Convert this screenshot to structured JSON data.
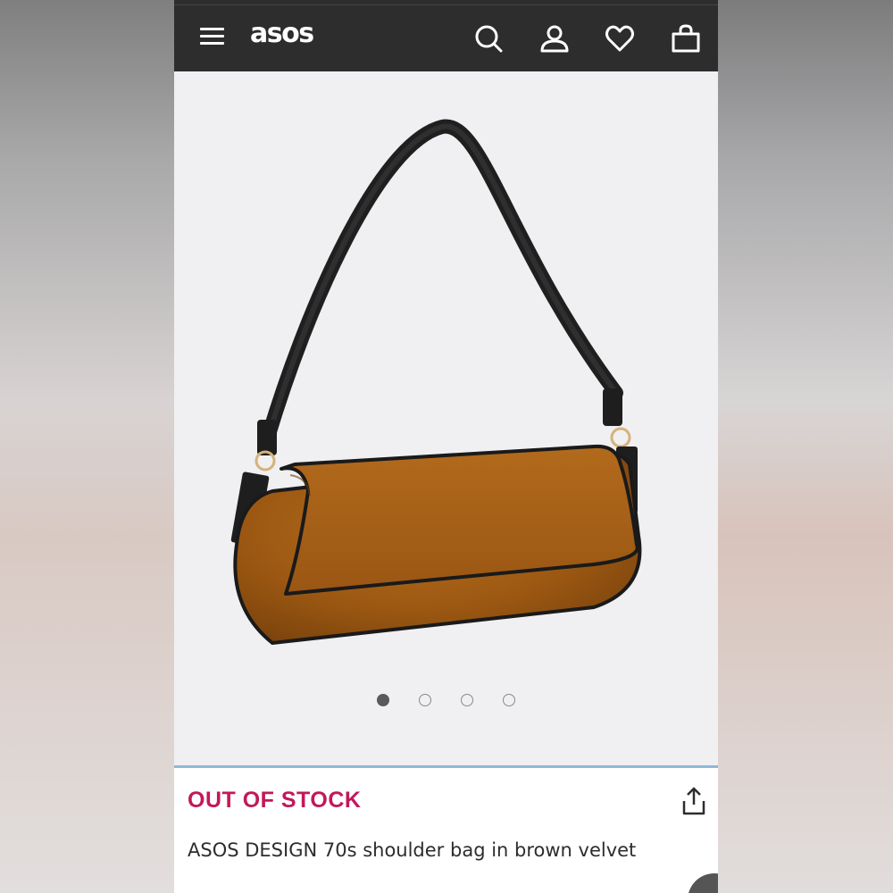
{
  "header": {
    "logo": "asos",
    "icons": [
      "menu-icon",
      "search-icon",
      "account-icon",
      "heart-icon",
      "bag-icon"
    ]
  },
  "gallery": {
    "image": "brown velvet 70s shoulder bag",
    "slide_count": 4,
    "active_slide": 1
  },
  "product": {
    "stock_status": "OUT OF STOCK",
    "title": "ASOS DESIGN 70s shoulder bag in brown velvet",
    "share_icon": "share-icon"
  },
  "colors": {
    "header_bg": "#2d2d2d",
    "stock_status": "#c2185b",
    "divider": "#8fb8d8"
  }
}
